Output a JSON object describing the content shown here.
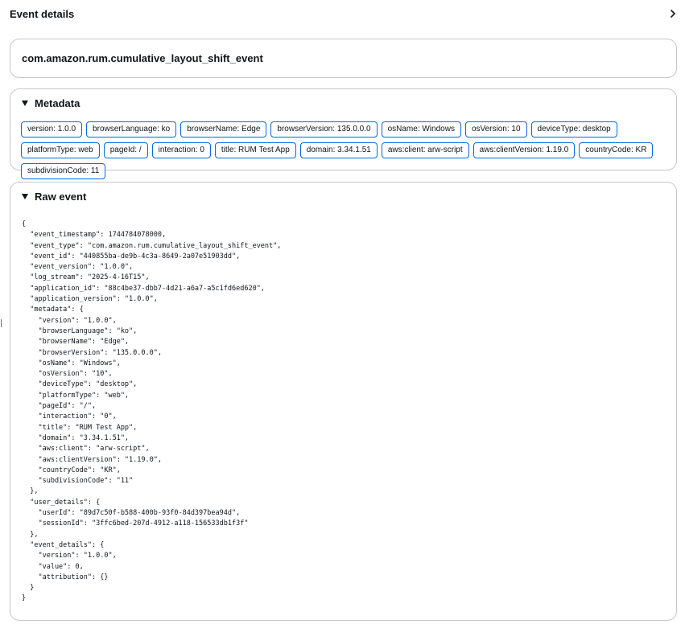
{
  "panel": {
    "title": "Event details"
  },
  "event_type": "com.amazon.rum.cumulative_layout_shift_event",
  "metadata_section": {
    "title": "Metadata",
    "tags": [
      "version: 1.0.0",
      "browserLanguage: ko",
      "browserName: Edge",
      "browserVersion: 135.0.0.0",
      "osName: Windows",
      "osVersion: 10",
      "deviceType: desktop",
      "platformType: web",
      "pageId: /",
      "interaction: 0",
      "title: RUM Test App",
      "domain: 3.34.1.51",
      "aws:client: arw-script",
      "aws:clientVersion: 1.19.0",
      "countryCode: KR",
      "subdivisionCode: 11"
    ]
  },
  "raw_section": {
    "title": "Raw event",
    "json": "{\n  \"event_timestamp\": 1744784078000,\n  \"event_type\": \"com.amazon.rum.cumulative_layout_shift_event\",\n  \"event_id\": \"440855ba-de9b-4c3a-8649-2a07e51903dd\",\n  \"event_version\": \"1.0.0\",\n  \"log_stream\": \"2025-4-16T15\",\n  \"application_id\": \"88c4be37-dbb7-4d21-a6a7-a5c1fd6ed620\",\n  \"application_version\": \"1.0.0\",\n  \"metadata\": {\n    \"version\": \"1.0.0\",\n    \"browserLanguage\": \"ko\",\n    \"browserName\": \"Edge\",\n    \"browserVersion\": \"135.0.0.0\",\n    \"osName\": \"Windows\",\n    \"osVersion\": \"10\",\n    \"deviceType\": \"desktop\",\n    \"platformType\": \"web\",\n    \"pageId\": \"/\",\n    \"interaction\": \"0\",\n    \"title\": \"RUM Test App\",\n    \"domain\": \"3.34.1.51\",\n    \"aws:client\": \"arw-script\",\n    \"aws:clientVersion\": \"1.19.0\",\n    \"countryCode\": \"KR\",\n    \"subdivisionCode\": \"11\"\n  },\n  \"user_details\": {\n    \"userId\": \"89d7c50f-b588-400b-93f0-84d397bea94d\",\n    \"sessionId\": \"3ffc6bed-207d-4912-a118-156533db1f3f\"\n  },\n  \"event_details\": {\n    \"version\": \"1.0.0\",\n    \"value\": 0,\n    \"attribution\": {}\n  }\n}"
  },
  "icons": {
    "collapse_panel": "chevron-right-icon",
    "section_toggle": "caret-down-icon"
  },
  "colors": {
    "tag_border": "#006ce0",
    "card_border": "#c6c6cd",
    "text": "#0f141a"
  }
}
